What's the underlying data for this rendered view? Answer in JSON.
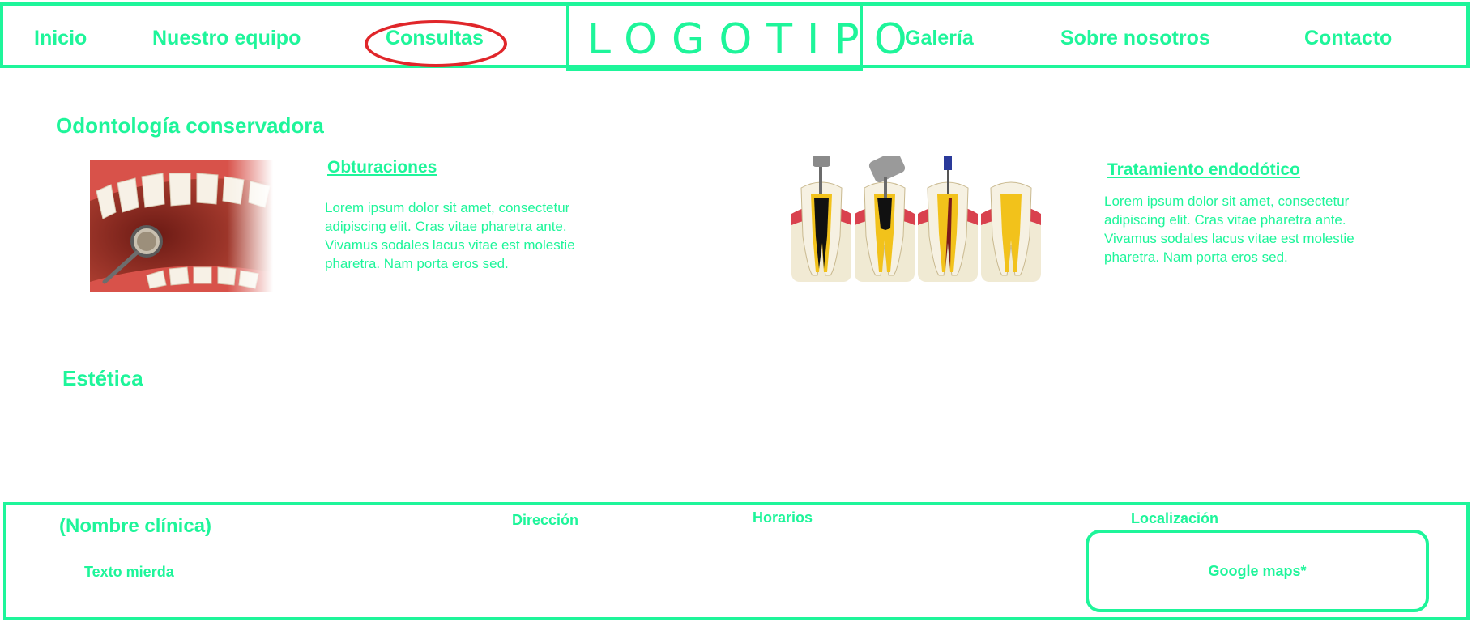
{
  "colors": {
    "accent": "#1ef59a",
    "highlight": "#e0262a"
  },
  "nav": {
    "items": [
      {
        "label": "Inicio"
      },
      {
        "label": "Nuestro equipo"
      },
      {
        "label": "Consultas"
      },
      {
        "label": "Galería"
      },
      {
        "label": "Sobre nosotros"
      },
      {
        "label": "Contacto"
      }
    ],
    "logo": "LOGOTIPO",
    "highlighted_item": "Consultas"
  },
  "sections": {
    "conservadora": {
      "title": "Odontología conservadora",
      "items": [
        {
          "title": "Obturaciones",
          "text": "Lorem ipsum dolor sit amet, consectetur adipiscing elit. Cras vitae pharetra ante. Vivamus sodales lacus vitae est molestie pharetra. Nam porta eros sed.",
          "image_icon": "teeth-mirror-image"
        },
        {
          "title": "Tratamiento endodótico",
          "text": "Lorem ipsum dolor sit amet, consectetur adipiscing elit. Cras vitae pharetra ante. Vivamus sodales lacus vitae est molestie pharetra. Nam porta eros sed.",
          "image_icon": "root-canal-image"
        }
      ]
    },
    "estetica": {
      "title": "Estética"
    }
  },
  "footer": {
    "clinic_name": "(Nombre clínica)",
    "text": "Texto mierda",
    "direccion": "Dirección",
    "horarios": "Horarios",
    "localizacion": "Localización",
    "map_label": "Google maps*"
  }
}
